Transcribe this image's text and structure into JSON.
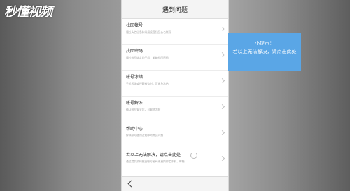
{
  "watermark": "秒懂视频",
  "header": {
    "title": "遇到问题"
  },
  "menu": [
    {
      "title": "找回帐号",
      "sub": "通过实名信息和常用设置找回实名帐号"
    },
    {
      "title": "找回密码",
      "sub": "通过帐号绑定的手机、邮箱找回密码"
    },
    {
      "title": "帐号冻结",
      "sub": "手机丢失或怀疑被盗时，可紧急冻结"
    },
    {
      "title": "帐号解冻",
      "sub": "确认帐号安全后，可解除冻结"
    },
    {
      "title": "帮助中心",
      "sub": "解决帐号使用过程中的常见问题"
    },
    {
      "title": "若以上无法解决，请点击此处",
      "sub": "通过提交资料找回帐号密码或更换绑定手机、邮箱"
    }
  ],
  "tip": {
    "title": "小提示：",
    "text": "若以上无法解决，请点击此处"
  },
  "colors": {
    "tip_bg": "#5aa6e6",
    "page_bg": "#ffffff"
  },
  "icons": {
    "back": "chevron-left-icon",
    "arrow": "chevron-right-icon",
    "loading": "loading-spinner-icon"
  }
}
